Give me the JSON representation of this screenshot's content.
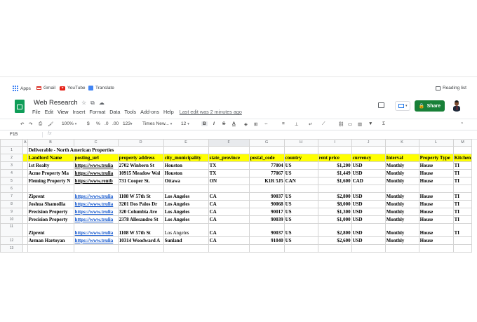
{
  "bookmarks": [
    {
      "label": "Apps",
      "icon": "apps-icon"
    },
    {
      "label": "Gmail",
      "icon": "gmail-icon"
    },
    {
      "label": "YouTube",
      "icon": "youtube-icon"
    },
    {
      "label": "Translate",
      "icon": "translate-icon"
    }
  ],
  "reading_list": "Reading list",
  "doc": {
    "title": "Web Research",
    "menu": [
      "File",
      "Edit",
      "View",
      "Insert",
      "Format",
      "Data",
      "Tools",
      "Add-ons",
      "Help"
    ],
    "last_edit": "Last edit was 2 minutes ago"
  },
  "share_label": "Share",
  "toolbar": {
    "zoom": "100%",
    "currency": "$",
    "percent": "%",
    "dec_less": ".0",
    "dec_more": ".00",
    "format_more": "123",
    "font": "Times New...",
    "font_size": "12",
    "bold": "B",
    "italic": "I",
    "strike": "S",
    "text_color": "A"
  },
  "name_box": "F15",
  "fx": "fx",
  "columns": [
    "A",
    "B",
    "C",
    "D",
    "E",
    "F",
    "G",
    "H",
    "I",
    "J",
    "K",
    "L",
    "M"
  ],
  "rows": [
    {
      "n": "1",
      "cells": [
        "",
        "Deliverable - North American Properties",
        "",
        "",
        "",
        "",
        "",
        "",
        "",
        "",
        "",
        "",
        ""
      ]
    },
    {
      "n": "2",
      "cells": [
        "",
        "Landlord Name",
        "posting_url",
        "property address",
        "city_municipality",
        "state_province",
        "postal_code",
        "country",
        "rent price",
        "currency",
        "Interval",
        "Property Type",
        "Kitchen"
      ]
    },
    {
      "n": "3",
      "cells": [
        "",
        "1st Realty",
        "https://www.trulia",
        "2702 Winbern St",
        "Houston",
        "TX",
        "77004",
        "US",
        "$1,200",
        "USD",
        "Monthly",
        "House",
        "TI"
      ]
    },
    {
      "n": "4",
      "cells": [
        "",
        "Acme Property Ma",
        "https://www.trulia",
        "10915 Meadow Wal",
        "Houston",
        "TX",
        "77067",
        "US",
        "$1,449",
        "USD",
        "Monthly",
        "House",
        "TI"
      ]
    },
    {
      "n": "5",
      "cells": [
        "",
        "Fleming Property N",
        "https://www.rentb",
        "731 Cooper St.",
        "Ottawa",
        "ON",
        "K1R 5J5",
        "CAN",
        "$1,600",
        "CAD",
        "Monthly",
        "House",
        "TI"
      ]
    },
    {
      "n": "6",
      "cells": [
        "",
        "",
        "",
        "",
        "",
        "",
        "",
        "",
        "",
        "",
        "",
        "",
        ""
      ]
    },
    {
      "n": "7",
      "cells": [
        "",
        "Ziprent",
        "https://www.trulia",
        "1108 W 57th St",
        "Los Angeles",
        "CA",
        "90037",
        "US",
        "$2,800",
        "USD",
        "Monthly",
        "House",
        "TI"
      ]
    },
    {
      "n": "8",
      "cells": [
        "",
        "Joshua Shamoilia",
        "https://www.trulia",
        "3201 Dos Palos Dr",
        "Los Angeles",
        "CA",
        "90068",
        "US",
        "$8,000",
        "USD",
        "Monthly",
        "House",
        "TI"
      ]
    },
    {
      "n": "9",
      "cells": [
        "",
        "Precision Property",
        "https://www.trulia",
        "320 Columbia Ave",
        "Los Angeles",
        "CA",
        "90017",
        "US",
        "$1,300",
        "USD",
        "Monthly",
        "House",
        "TI"
      ]
    },
    {
      "n": "10",
      "cells": [
        "",
        "Precision Property",
        "https://www.trulia",
        "2378 Allesandro St",
        "Los Angeles",
        "CA",
        "90039",
        "US",
        "$1,000",
        "USD",
        "Monthly",
        "House",
        "TI"
      ]
    },
    {
      "n": "11",
      "cells": [
        "",
        "Ziprent",
        "https://www.trulia",
        "1108 W 57th St",
        "Los Angeles",
        "CA",
        "90037",
        "US",
        "$2,800",
        "USD",
        "Monthly",
        "House",
        "TI"
      ]
    },
    {
      "n": "12",
      "cells": [
        "",
        "Arman Hartoyan",
        "https://www.trulia",
        "10314 Woodward A",
        "Sunland",
        "CA",
        "91040",
        "US",
        "$2,600",
        "USD",
        "Monthly",
        "House",
        ""
      ]
    },
    {
      "n": "13",
      "cells": [
        "",
        "",
        "",
        "",
        "",
        "",
        "",
        "",
        "",
        "",
        "",
        "",
        ""
      ]
    }
  ],
  "colors": {
    "header_fill": "#ffff00",
    "link": "#1155cc",
    "share": "#188038",
    "sheets_logo": "#0f9d58"
  }
}
